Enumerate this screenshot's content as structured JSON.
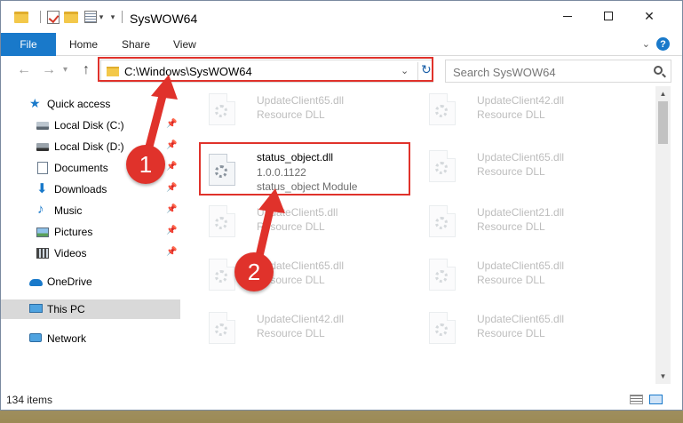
{
  "window": {
    "title": "SysWOW64",
    "controls": {
      "minimize": "minimize",
      "maximize": "maximize",
      "close": "✕"
    }
  },
  "ribbon": {
    "tabs": [
      "File",
      "Home",
      "Share",
      "View"
    ],
    "help": "?"
  },
  "address_bar": {
    "path": "C:\\Windows\\SysWOW64"
  },
  "search": {
    "placeholder": "Search SysWOW64"
  },
  "sidebar": {
    "items": [
      {
        "label": "Quick access",
        "icon": "star-icon",
        "pinned": false
      },
      {
        "label": "Local Disk (C:)",
        "icon": "drive-icon",
        "pinned": true
      },
      {
        "label": "Local Disk (D:)",
        "icon": "drive-icon",
        "pinned": true
      },
      {
        "label": "Documents",
        "icon": "documents-icon",
        "pinned": true
      },
      {
        "label": "Downloads",
        "icon": "download-icon",
        "pinned": true
      },
      {
        "label": "Music",
        "icon": "music-icon",
        "pinned": true
      },
      {
        "label": "Pictures",
        "icon": "pictures-icon",
        "pinned": true
      },
      {
        "label": "Videos",
        "icon": "videos-icon",
        "pinned": true
      },
      {
        "label": "OneDrive",
        "icon": "cloud-icon",
        "pinned": false
      },
      {
        "label": "This PC",
        "icon": "computer-icon",
        "pinned": false,
        "selected": true
      },
      {
        "label": "Network",
        "icon": "network-icon",
        "pinned": false
      }
    ]
  },
  "files": [
    {
      "name": "UpdateClient65.dll",
      "lines": [
        "Resource DLL"
      ],
      "faded": true
    },
    {
      "name": "UpdateClient42.dll",
      "lines": [
        "Resource DLL"
      ],
      "faded": true
    },
    {
      "name": "status_object.dll",
      "lines": [
        "1.0.0.1122",
        "status_object Module"
      ],
      "faded": false
    },
    {
      "name": "UpdateClient65.dll",
      "lines": [
        "Resource DLL"
      ],
      "faded": true
    },
    {
      "name": "UpdateClient5.dll",
      "lines": [
        "Resource DLL"
      ],
      "faded": true
    },
    {
      "name": "UpdateClient21.dll",
      "lines": [
        "Resource DLL"
      ],
      "faded": true
    },
    {
      "name": "UpdateClient65.dll",
      "lines": [
        "Resource DLL"
      ],
      "faded": true
    },
    {
      "name": "UpdateClient65.dll",
      "lines": [
        "Resource DLL"
      ],
      "faded": true
    },
    {
      "name": "UpdateClient42.dll",
      "lines": [
        "Resource DLL"
      ],
      "faded": true
    },
    {
      "name": "UpdateClient65.dll",
      "lines": [
        "Resource DLL"
      ],
      "faded": true
    }
  ],
  "status": {
    "item_count": "134 items"
  },
  "annotations": {
    "step1": "1",
    "step2": "2",
    "color": "#e0322b"
  },
  "colors": {
    "accent": "#1979ca",
    "highlight": "#e0322b"
  }
}
